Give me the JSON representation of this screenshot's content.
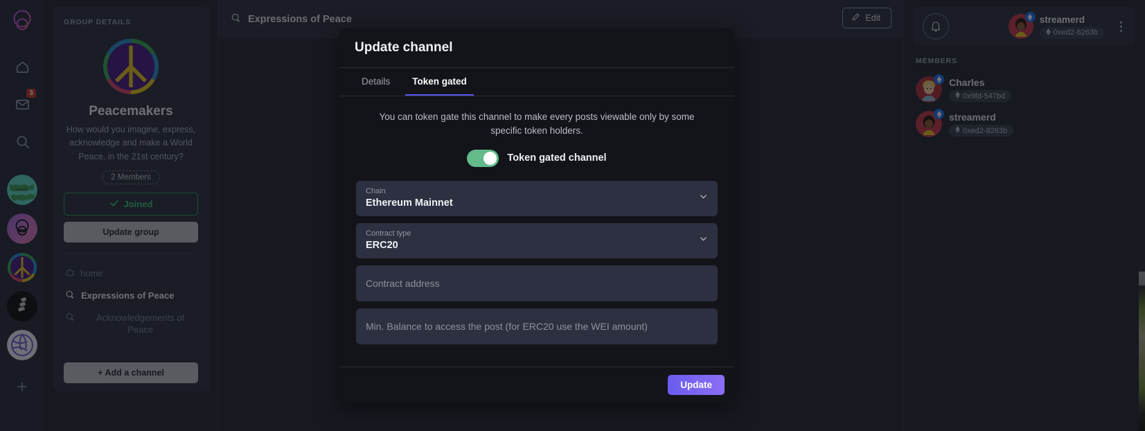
{
  "rail": {
    "logo_name": "app-logo",
    "icons": [
      {
        "name": "home-icon",
        "label": "Home",
        "badge": null
      },
      {
        "name": "mail-icon",
        "label": "Messages",
        "badge": "3"
      },
      {
        "name": "search-icon",
        "label": "Search",
        "badge": null
      }
    ],
    "groups": [
      {
        "name": "group-avatar-earth",
        "label": "Earth"
      },
      {
        "name": "group-avatar-purple",
        "label": "Purple group"
      },
      {
        "name": "group-avatar-peacemakers",
        "label": "Peacemakers"
      },
      {
        "name": "group-avatar-dark",
        "label": "Dark group"
      },
      {
        "name": "group-avatar-network",
        "label": "Network group"
      }
    ],
    "add_label": "+"
  },
  "group_panel": {
    "section_label": "GROUP DETAILS",
    "name": "Peacemakers",
    "description": "How would you imagine, express, acknowledge and make a World Peace, in the 21st century?",
    "members_chip": "2 Members",
    "joined_label": "Joined",
    "update_group_label": "Update group",
    "channels": [
      {
        "label": "home",
        "icon": "home-icon",
        "state": "muted"
      },
      {
        "label": "Expressions of Peace",
        "icon": "channel-icon",
        "state": "active"
      },
      {
        "label": "Acknowledgements of Peace",
        "icon": "channel-icon",
        "state": "muted"
      }
    ],
    "add_channel_label": "+ Add a channel"
  },
  "main": {
    "channel_title": "Expressions of Peace",
    "edit_label": "Edit"
  },
  "right": {
    "profile": {
      "username": "streamerd",
      "address": "0xed2-8263b"
    },
    "members_label": "MEMBERS",
    "members": [
      {
        "name": "Charles",
        "address": "0x9fd-547bd"
      },
      {
        "name": "streamerd",
        "address": "0xed2-8263b"
      }
    ]
  },
  "modal": {
    "title": "Update channel",
    "tabs": [
      {
        "label": "Details",
        "active": false
      },
      {
        "label": "Token gated",
        "active": true
      }
    ],
    "description": "You can token gate this channel to make every posts viewable only by some specific token holders.",
    "toggle_label": "Token gated channel",
    "toggle_on": true,
    "fields": {
      "chain_label": "Chain",
      "chain_value": "Ethereum Mainnet",
      "contract_type_label": "Contract type",
      "contract_type_value": "ERC20",
      "contract_address_placeholder": "Contract address",
      "contract_address_value": "",
      "min_balance_placeholder": "Min. Balance to access the post (for ERC20 use the WEI amount)",
      "min_balance_value": ""
    },
    "update_label": "Update"
  },
  "colors": {
    "accent": "#6a5cf0",
    "toggle_on": "#63ba8b",
    "joined_green": "#3fc47f",
    "badge_red": "#c0392f"
  }
}
